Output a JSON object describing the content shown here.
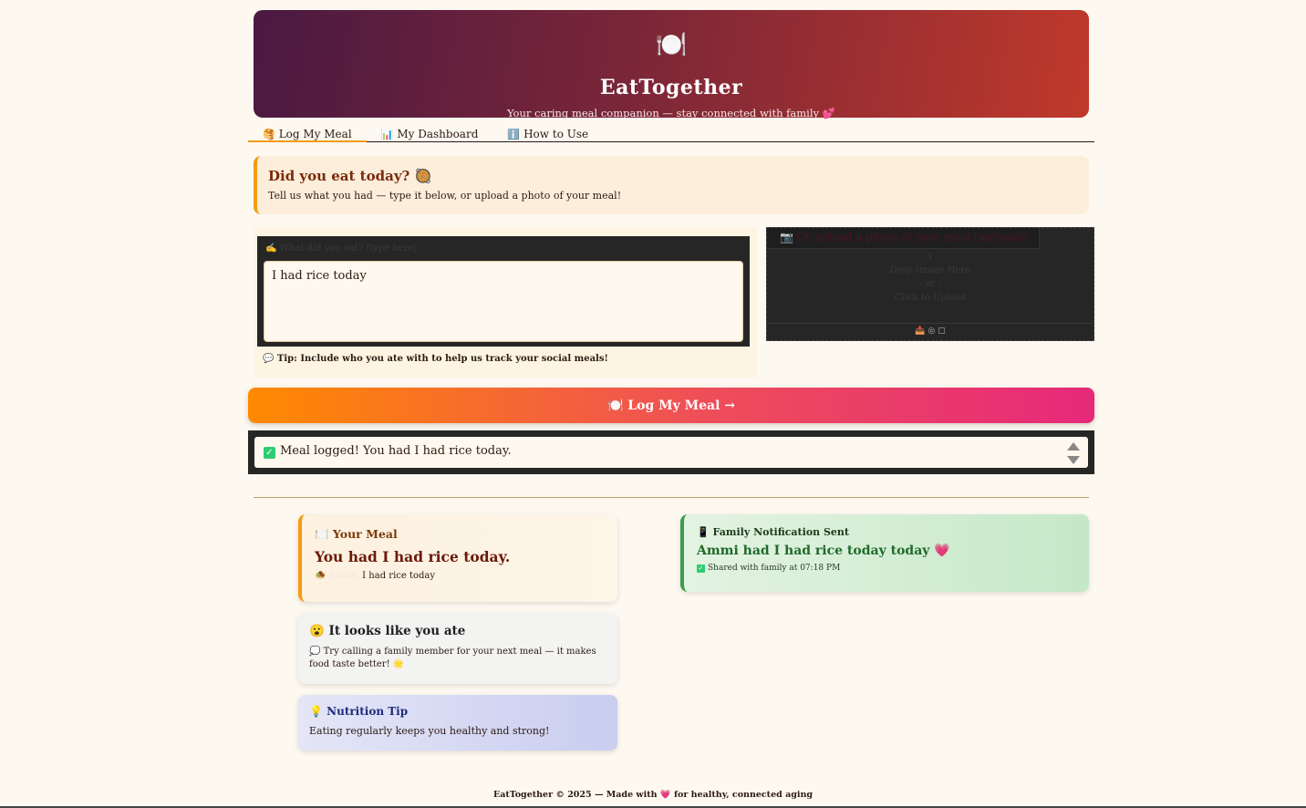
{
  "header": {
    "logo_icon": "🍽️",
    "title": "EatTogether",
    "subtitle": "Your caring meal companion — stay connected with family 💕"
  },
  "tabs": [
    {
      "icon": "🥞",
      "label": "Log My Meal",
      "active": true
    },
    {
      "icon": "📊",
      "label": "My Dashboard",
      "active": false
    },
    {
      "icon": "ℹ️",
      "label": "How to Use",
      "active": false
    }
  ],
  "prompt": {
    "title": "Did you eat today? 🥘",
    "text": "Tell us what you had — type it below, or upload a photo of your meal!"
  },
  "input": {
    "label_icon": "✍️",
    "label": "What did you eat? (type here)",
    "value": "I had rice today",
    "tip": "💬 Tip: Include who you ate with to help us track your social meals!"
  },
  "upload": {
    "label": "📷 Or upload a photo of your meal (optional)",
    "icon": "⇪",
    "drop_text": "Drop Image Here",
    "or_text": "- or -",
    "click_text": "Click to Upload",
    "toolbar": "📤 ◎ ▢"
  },
  "log_button": {
    "label": "🍽️ Log My Meal →"
  },
  "result": {
    "check": "✓",
    "text": "Meal logged! You had I had rice today."
  },
  "meal_card": {
    "title": "🍽️ Your Meal",
    "big": "You had I had rice today.",
    "icon": "🧆",
    "faint": "Foods:",
    "detail": "I had rice today"
  },
  "family_card": {
    "title": "📱 Family Notification Sent",
    "big": "Ammi had I had rice today today 💗",
    "check": "✓",
    "detail": "Shared with family at 07:18 PM"
  },
  "ate_card": {
    "title": "😮 It looks like you ate",
    "text": "💭 Try calling a family member for your next meal — it makes food taste better! 🌟"
  },
  "nutrition_card": {
    "title": "💡 Nutrition Tip",
    "text": "Eating regularly keeps you healthy and strong!"
  },
  "footer": "EatTogether © 2025 — Made with 💗 for healthy, connected aging",
  "colors": {
    "accent": "#f39c12",
    "success": "#2ecc71",
    "header_start": "#4a1942",
    "header_end": "#c0392b"
  }
}
